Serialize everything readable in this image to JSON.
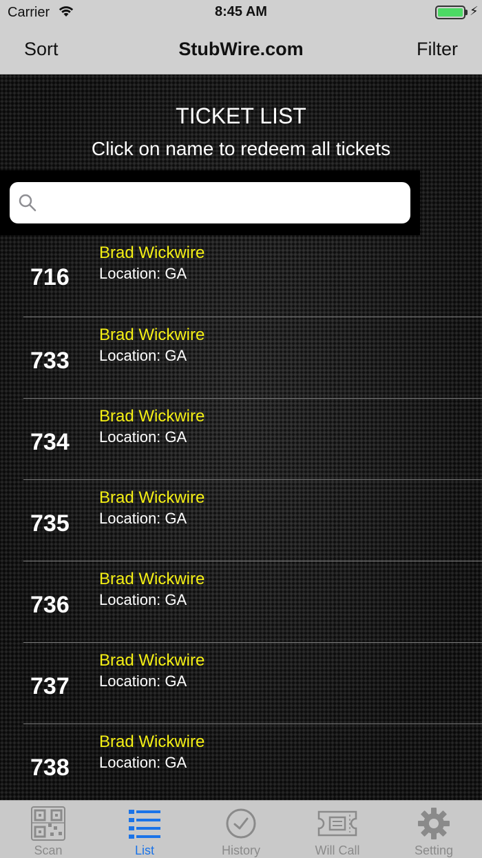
{
  "status": {
    "carrier": "Carrier",
    "time": "8:45 AM"
  },
  "nav": {
    "left": "Sort",
    "title": "StubWire.com",
    "right": "Filter"
  },
  "main": {
    "heading": "TICKET LIST",
    "subtitle": "Click on name to redeem all tickets",
    "search_placeholder": ""
  },
  "tickets": [
    {
      "number": "716",
      "name": "Brad Wickwire",
      "location": "Location: GA"
    },
    {
      "number": "733",
      "name": "Brad Wickwire",
      "location": "Location: GA"
    },
    {
      "number": "734",
      "name": "Brad Wickwire",
      "location": "Location: GA"
    },
    {
      "number": "735",
      "name": "Brad Wickwire",
      "location": "Location: GA"
    },
    {
      "number": "736",
      "name": "Brad Wickwire",
      "location": "Location: GA"
    },
    {
      "number": "737",
      "name": "Brad Wickwire",
      "location": "Location: GA"
    },
    {
      "number": "738",
      "name": "Brad Wickwire",
      "location": "Location: GA"
    }
  ],
  "tabs": [
    {
      "label": "Scan",
      "icon": "qr-code-icon",
      "active": false
    },
    {
      "label": "List",
      "icon": "list-icon",
      "active": true
    },
    {
      "label": "History",
      "icon": "clock-icon",
      "active": false
    },
    {
      "label": "Will Call",
      "icon": "ticket-icon",
      "active": false
    },
    {
      "label": "Setting",
      "icon": "gear-icon",
      "active": false
    }
  ],
  "colors": {
    "accent": "#1a73e8",
    "name_yellow": "#f5f014",
    "battery_green": "#4cd964"
  }
}
